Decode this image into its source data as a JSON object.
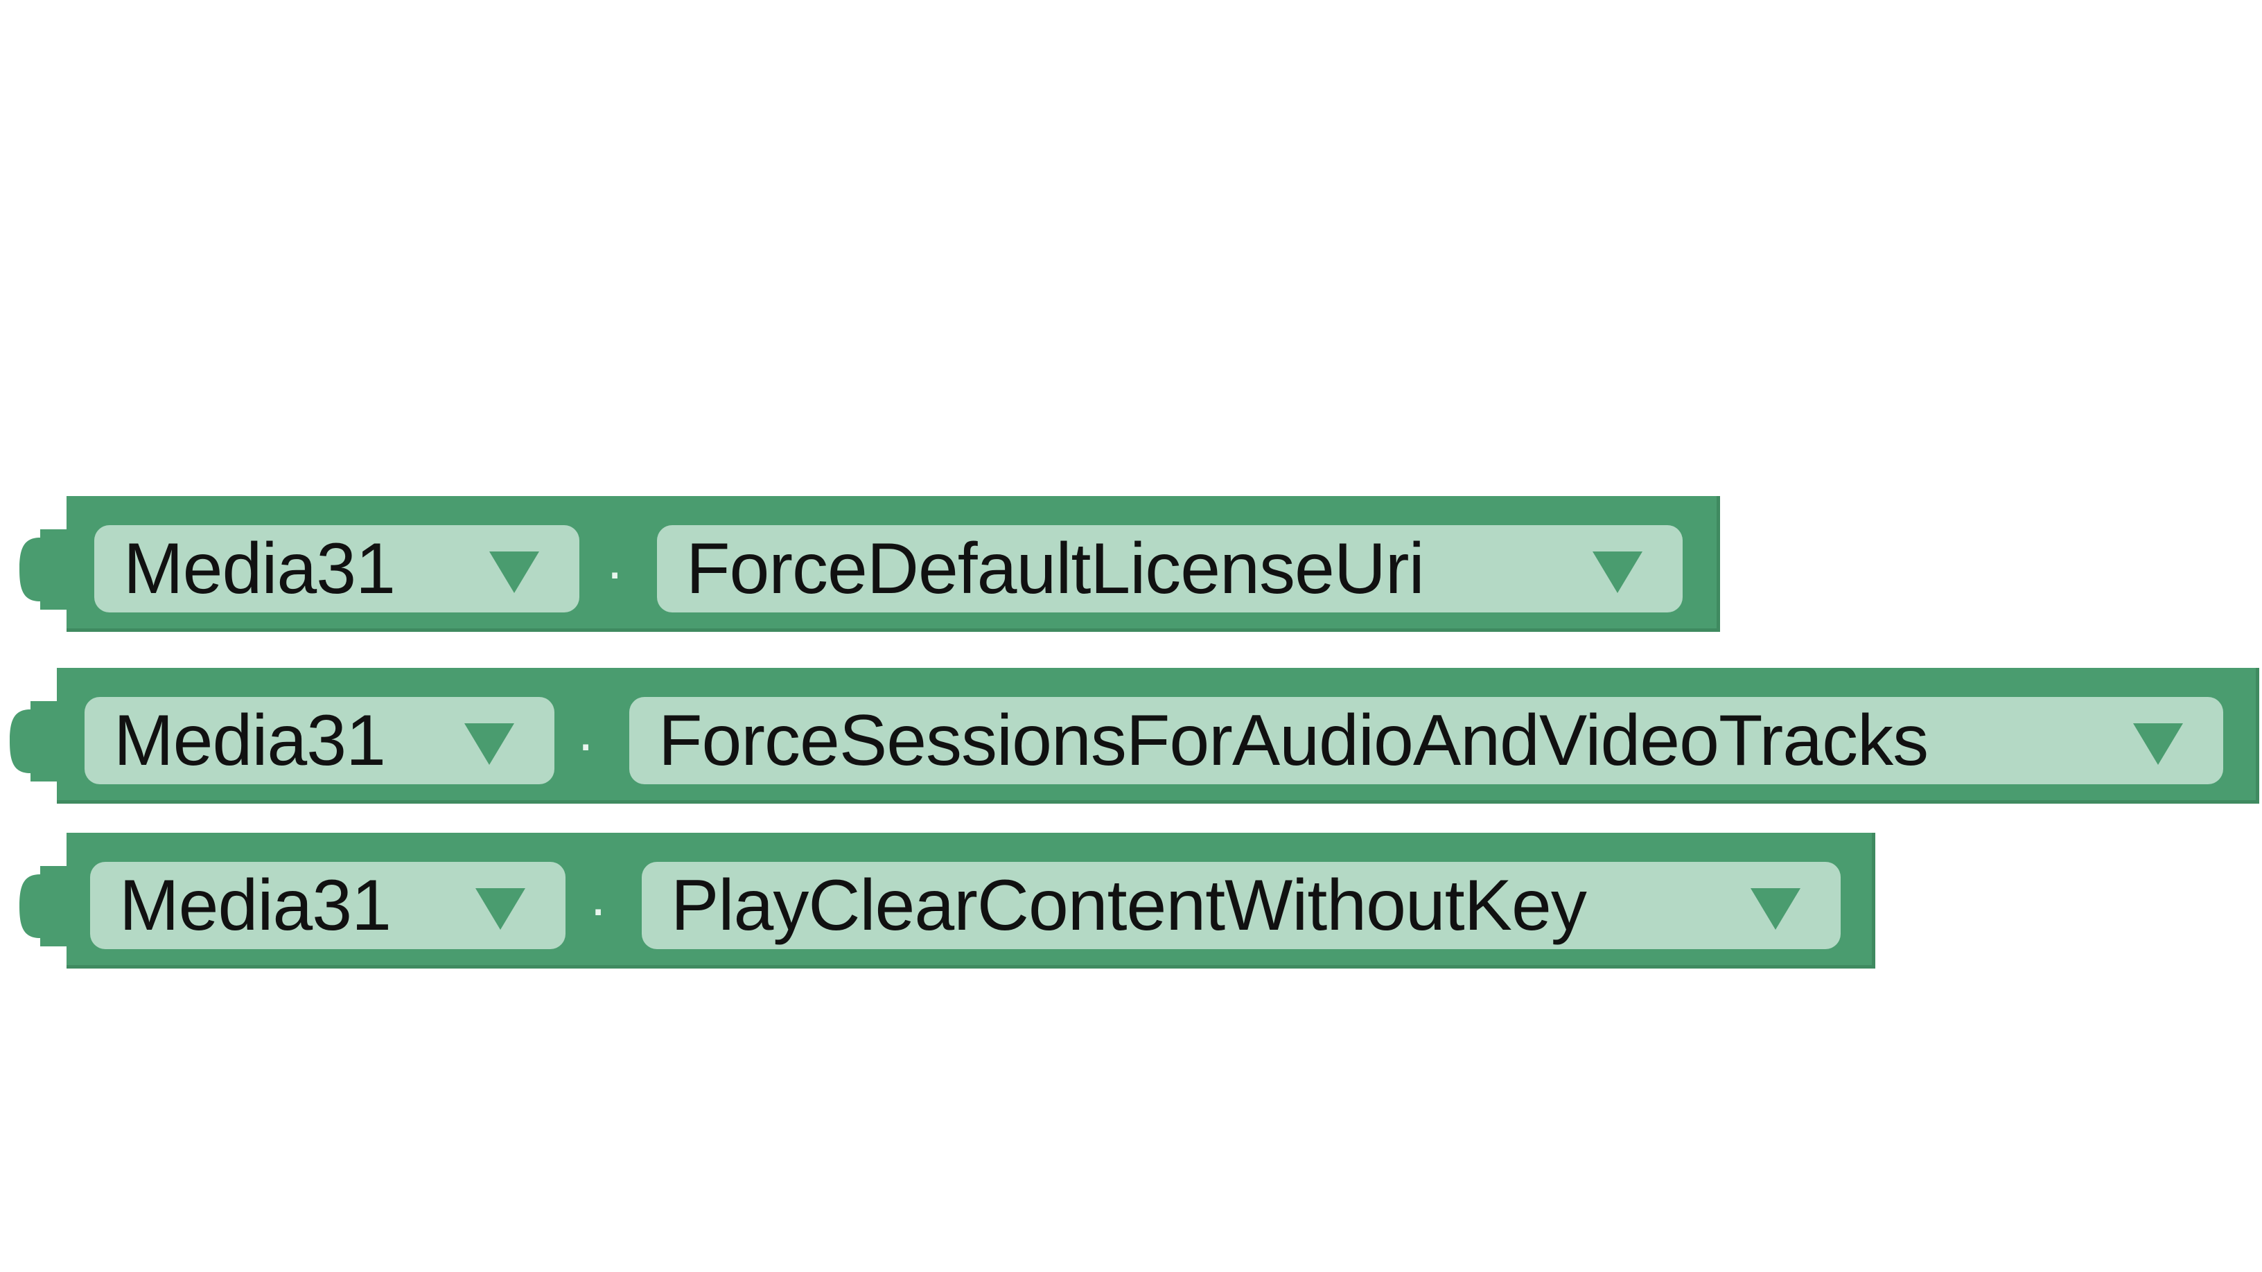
{
  "colors": {
    "block": "#4a9c6f",
    "block_shadow": "#3f8a60",
    "field": "#b4d9c5",
    "arrow": "#4a9c6f"
  },
  "blocks": [
    {
      "component": "Media31",
      "separator": ".",
      "property": "ForceDefaultLicenseUri"
    },
    {
      "component": "Media31",
      "separator": ".",
      "property": "ForceSessionsForAudioAndVideoTracks"
    },
    {
      "component": "Media31",
      "separator": ".",
      "property": "PlayClearContentWithoutKey"
    }
  ]
}
